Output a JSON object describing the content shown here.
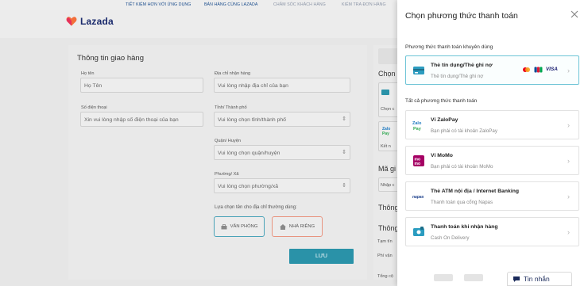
{
  "topbar": {
    "links": [
      "TIẾT KIỆM HƠN VỚI ỨNG DỤNG",
      "BÁN HÀNG CÙNG LAZADA",
      "CHĂM SÓC KHÁCH HÀNG",
      "KIỂM TRA ĐƠN HÀNG"
    ]
  },
  "header": {
    "brand": "Lazada",
    "brand_color": "#f57224"
  },
  "shipping": {
    "title": "Thông tin giao hàng",
    "name_label": "Họ tên",
    "name_placeholder": "Họ Tên",
    "phone_label": "Số điện thoại",
    "phone_placeholder": "Xin vui lòng nhập số điện thoại của bạn",
    "address_label": "Địa chỉ nhận hàng",
    "address_placeholder": "Vui lòng nhập địa chỉ của bạn",
    "province_label": "Tỉnh/ Thành phố",
    "province_placeholder": "Vui lòng chọn tỉnh/thành phố",
    "district_label": "Quận/ Huyện",
    "district_placeholder": "Vui lòng chọn quận/huyện",
    "ward_label": "Phường/ Xã",
    "ward_placeholder": "Vui lòng chọn phường/xã",
    "label_prompt": "Lựa chọn tên cho địa chỉ thường dùng:",
    "office_label": "VĂN PHÒNG",
    "home_label": "NHÀ RIÊNG",
    "save_label": "LƯU"
  },
  "summary": {
    "chon": "Chọn",
    "chon_d": "Chọn c",
    "ket_n": "Kết n",
    "ma_gi": "Mã gi",
    "nhap_c": "Nhập c",
    "thong1": "Thông",
    "thong2": "Thông",
    "tam_tin": "Tạm tín",
    "phi_van": "Phí vận",
    "tong_c": "Tổng cộ"
  },
  "panel": {
    "title": "Chọn phương thức thanh toán",
    "recommended_heading": "Phương thức thanh toán khuyên dùng",
    "all_heading": "Tất cả phương thức thanh toán",
    "recommended": {
      "name": "Thẻ tín dụng/Thẻ ghi nợ",
      "desc": "Thẻ tín dụng/Thẻ ghi nợ",
      "brands": [
        "mastercard-icon",
        "jcb-icon",
        "VISA"
      ]
    },
    "methods": [
      {
        "name": "Ví ZaloPay",
        "desc": "Bạn phải có tài khoản ZaloPay",
        "icon": "zalopay-icon"
      },
      {
        "name": "Ví MoMo",
        "desc": "Bạn phải có tài khoản MoMo",
        "icon": "momo-icon"
      },
      {
        "name": "Thẻ ATM nội địa / Internet Banking",
        "desc": "Thanh toán qua cổng Napas",
        "icon": "napas-icon"
      },
      {
        "name": "Thanh toán khi nhận hàng",
        "desc": "Cash On Delivery",
        "icon": "cod-icon"
      }
    ]
  },
  "chat": {
    "label": "Tin nhắn"
  },
  "colors": {
    "accent": "#2a92a8",
    "selected_border": "#6cc4d6",
    "brand_navy": "#1a2a6c"
  }
}
